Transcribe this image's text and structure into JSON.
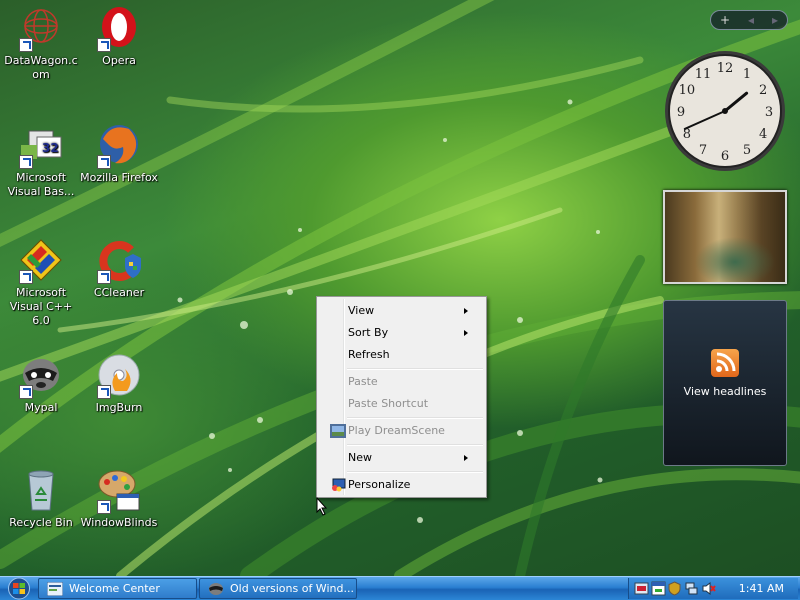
{
  "desktop": {
    "icons": [
      {
        "label": "DataWagon.c\nom",
        "name": "datawagon-icon"
      },
      {
        "label": "Opera",
        "name": "opera-icon"
      },
      {
        "label": "Microsoft\nVisual Bas...",
        "name": "visual-basic-icon"
      },
      {
        "label": "Mozilla Firefox",
        "name": "firefox-icon"
      },
      {
        "label": "Microsoft\nVisual C++ 6.0",
        "name": "visual-cpp-icon"
      },
      {
        "label": "CCleaner",
        "name": "ccleaner-icon"
      },
      {
        "label": "Mypal",
        "name": "mypal-icon"
      },
      {
        "label": "ImgBurn",
        "name": "imgburn-icon"
      },
      {
        "label": "Recycle Bin",
        "name": "recycle-bin-icon"
      },
      {
        "label": "WindowBlinds",
        "name": "windowblinds-icon"
      }
    ]
  },
  "gadgets": {
    "controls": {
      "add": "+",
      "prev": "◂",
      "next": "▸"
    },
    "clock": {
      "hour": 1,
      "minute": 41
    },
    "feeds": {
      "label": "View headlines"
    }
  },
  "context_menu": {
    "items": [
      {
        "label": "View",
        "enabled": true,
        "submenu": true
      },
      {
        "label": "Sort By",
        "enabled": true,
        "submenu": true
      },
      {
        "label": "Refresh",
        "enabled": true,
        "submenu": false
      },
      {
        "label": "Paste",
        "enabled": false,
        "submenu": false
      },
      {
        "label": "Paste Shortcut",
        "enabled": false,
        "submenu": false
      },
      {
        "label": "Play DreamScene",
        "enabled": false,
        "submenu": false
      },
      {
        "label": "New",
        "enabled": true,
        "submenu": true
      },
      {
        "label": "Personalize",
        "enabled": true,
        "submenu": false
      }
    ]
  },
  "taskbar": {
    "tasks": [
      {
        "label": "Welcome Center",
        "active": true
      },
      {
        "label": "Old versions of Wind...",
        "active": false
      }
    ],
    "clock": "1:41 AM"
  }
}
